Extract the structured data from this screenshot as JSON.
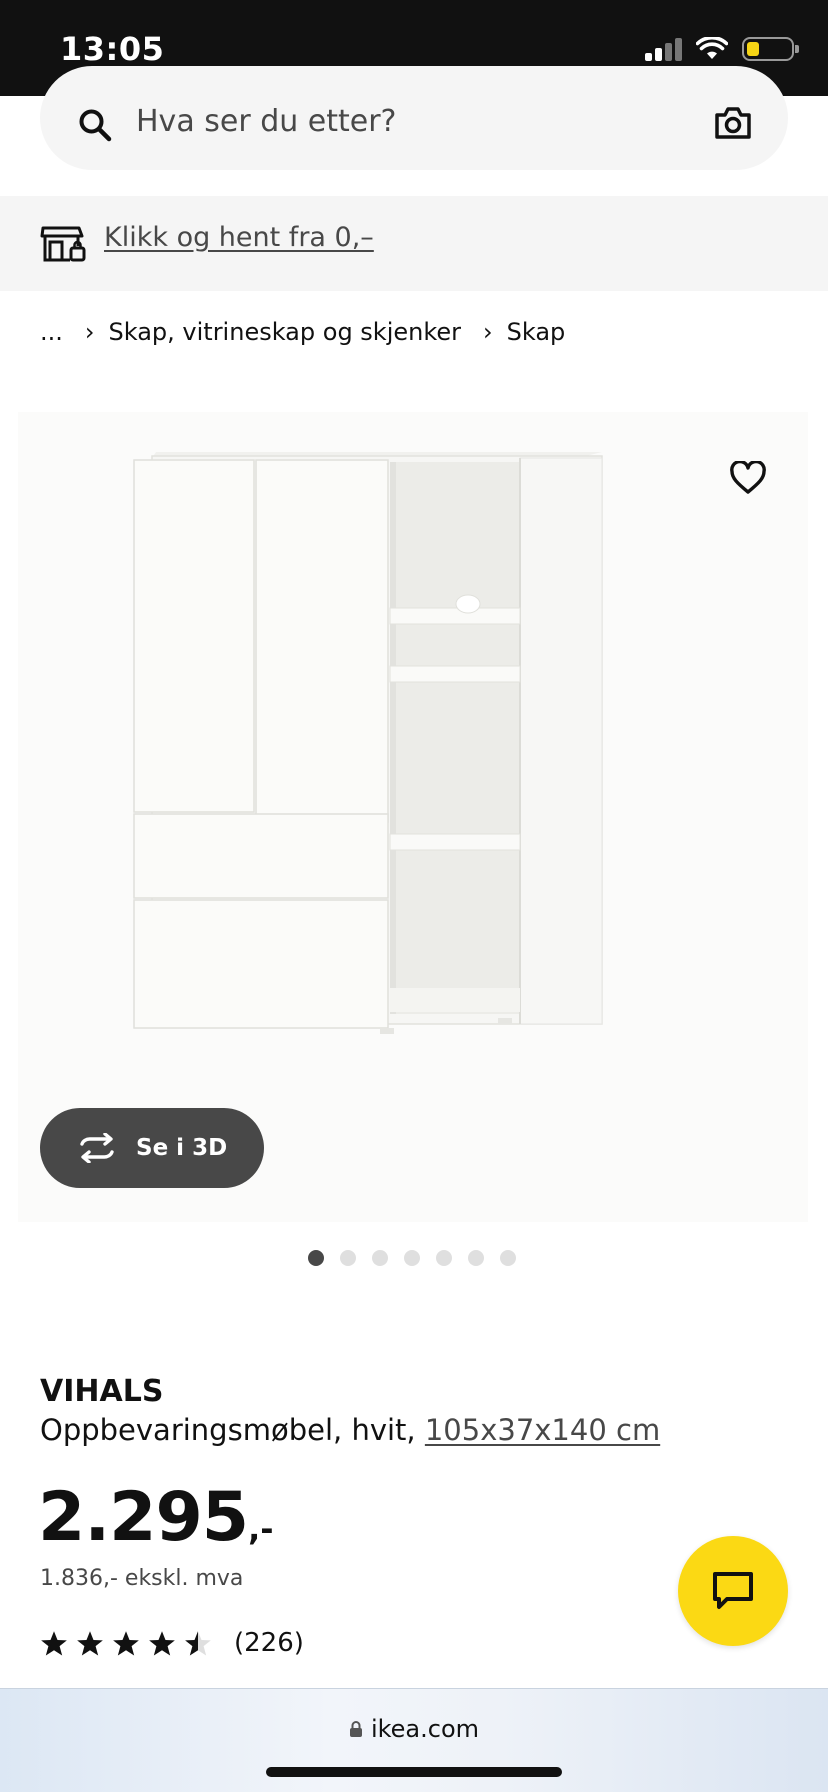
{
  "status_bar": {
    "time": "13:05",
    "battery_color": "#f5d415"
  },
  "search": {
    "placeholder": "Hva ser du etter?",
    "search_icon": "search-icon",
    "camera_icon": "camera-icon"
  },
  "promo": {
    "icon": "store-pickup-icon",
    "link_text": "Klikk og hent fra 0,–"
  },
  "breadcrumb": {
    "items": [
      "...",
      "Skap, vitrineskap og skjenker",
      "Skap"
    ]
  },
  "product_image": {
    "alt_icon": "product-photo",
    "favorite_icon": "heart-icon",
    "view_3d_label": "Se i 3D",
    "view_3d_icon": "rotate-3d-icon",
    "carousel_total": 7,
    "carousel_active": 1
  },
  "product": {
    "brand": "VIHALS",
    "description": "Oppbevaringsmøbel, hvit,",
    "dimensions": "105x37x140 cm",
    "price_integer": "2.295",
    "price_suffix": ",-",
    "price_ex_vat": "1.836,- ekskl. mva",
    "rating_value": 4.5,
    "rating_max": 5,
    "review_count": "(226)"
  },
  "chat": {
    "icon": "chat-icon",
    "color": "#fbd914"
  },
  "browser": {
    "url": "ikea.com",
    "lock_icon": "lock-icon"
  }
}
